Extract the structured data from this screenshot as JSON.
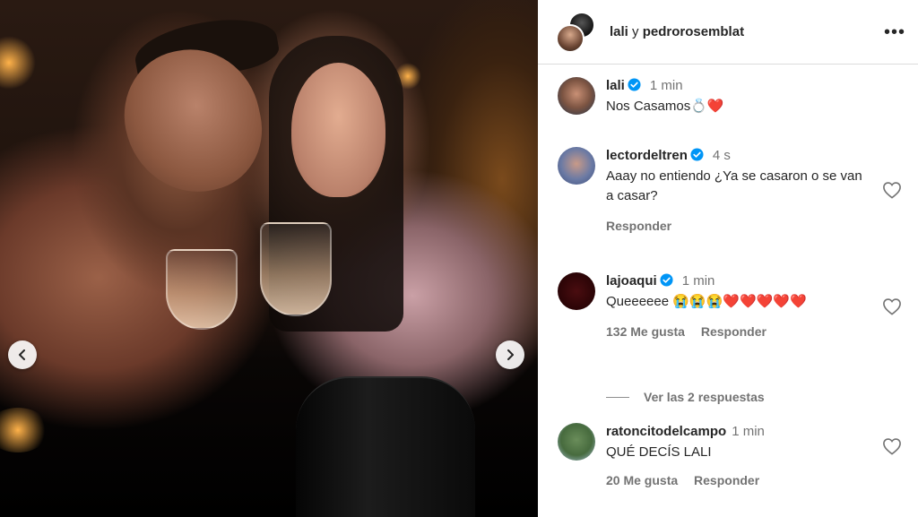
{
  "post": {
    "users": [
      "lali",
      "pedrorosemblat"
    ],
    "conjunction": "y"
  },
  "comments": [
    {
      "username": "lali",
      "verified": true,
      "time": "1 min",
      "text": "Nos Casamos💍❤️",
      "likes": "",
      "reply_label": ""
    },
    {
      "username": "lectordeltren",
      "verified": true,
      "time": "4 s",
      "text": "Aaay no entiendo ¿Ya se casaron o se van a casar?",
      "likes": "",
      "reply_label": "Responder"
    },
    {
      "username": "lajoaqui",
      "verified": true,
      "time": "1 min",
      "text": "Queeeeee 😭😭😭❤️❤️❤️❤️❤️",
      "likes": "132 Me gusta",
      "reply_label": "Responder",
      "view_replies": "Ver las 2 respuestas"
    },
    {
      "username": "ratoncitodelcampo",
      "verified": false,
      "time": "1 min",
      "text": "QUÉ DECÍS LALI",
      "likes": "20 Me gusta",
      "reply_label": "Responder"
    }
  ],
  "icons": {
    "more": "more-options-icon",
    "prev": "chevron-left-icon",
    "next": "chevron-right-icon",
    "like": "heart-outline-icon",
    "verified": "verified-badge-icon"
  },
  "colors": {
    "verified_blue": "#0095f6",
    "heart_red": "#e0102a",
    "meta_gray": "#737373"
  }
}
